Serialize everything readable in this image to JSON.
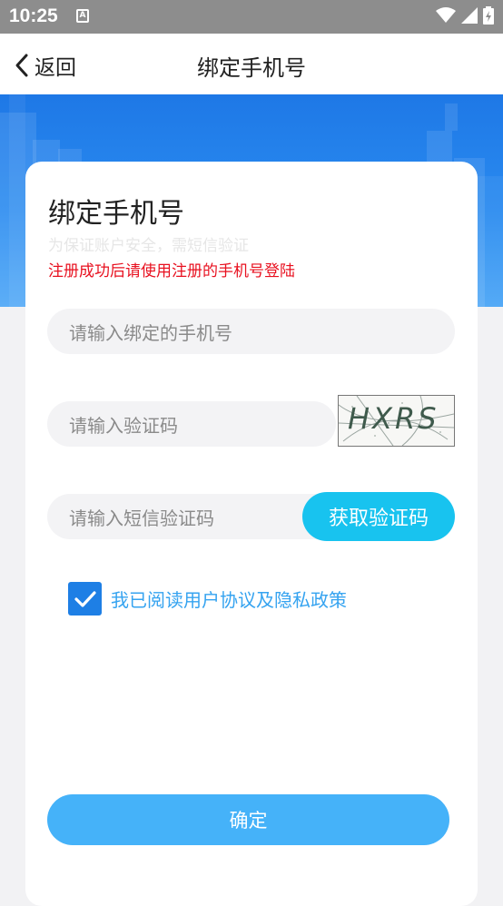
{
  "status_bar": {
    "time": "10:25",
    "notif_glyph": "A"
  },
  "nav": {
    "back_label": "返回",
    "title": "绑定手机号"
  },
  "card": {
    "heading": "绑定手机号",
    "subtitle": "为保证账户安全，需短信验证",
    "warning": "注册成功后请使用注册的手机号登陆"
  },
  "form": {
    "phone_placeholder": "请输入绑定的手机号",
    "captcha_placeholder": "请输入验证码",
    "captcha_text": "HXRS",
    "sms_placeholder": "请输入短信验证码",
    "sms_button": "获取验证码",
    "agree_checked": true,
    "agree_label": "我已阅读用户协议及隐私政策",
    "confirm_button": "确定"
  },
  "colors": {
    "banner": "#2a8bf0",
    "sms_button": "#18c3ef",
    "confirm_button": "#45b2f9",
    "warning_text": "#e8101f",
    "agree_text": "#35a3f0",
    "checkbox": "#1e7fe5"
  },
  "icons": [
    "back-chevron-icon",
    "wifi-icon",
    "signal-icon",
    "battery-icon",
    "check-icon",
    "notification-icon"
  ]
}
